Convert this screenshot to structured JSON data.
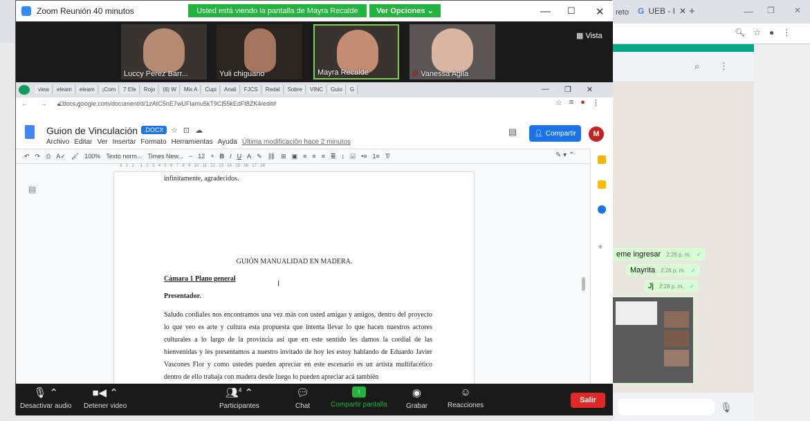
{
  "browser_bg": {
    "tab1": "reto",
    "tab2": "UEB - I",
    "new_tab": "+"
  },
  "whatsapp": {
    "messages": [
      {
        "text": "eme ingresar",
        "time": "2:28 p. m."
      },
      {
        "text": "Mayrita",
        "time": "2:28 p. m."
      },
      {
        "text": "Jj",
        "time": "2:28 p. m."
      }
    ],
    "plus": "+"
  },
  "zoom": {
    "title": "Zoom Reunión 40 minutos",
    "banner": "Usted está viendo la pantalla de Mayra Recalde",
    "view_options": "Ver Opciones",
    "vista": "Vista",
    "participants": [
      {
        "name": "Luccy Pérez Barr..."
      },
      {
        "name": "Yuli chiguano"
      },
      {
        "name": "Mayra Recalde"
      },
      {
        "name": "Vanessa Agila"
      }
    ],
    "controls": {
      "mute": "Desactivar audio",
      "video": "Detener video",
      "participants": "Participantes",
      "participants_count": "4",
      "chat": "Chat",
      "share": "Compartir pantalla",
      "record": "Grabar",
      "reactions": "Reacciones",
      "leave": "Salir"
    }
  },
  "chrome": {
    "tabs": [
      "view",
      "eleam",
      "eleam",
      "¡Com",
      "7 Efe",
      "Rojo",
      "(6) W",
      "Mix A",
      "Cupi",
      "Anali",
      "FJCS",
      "Redal",
      "Sobre",
      "VINC",
      "Guio",
      "G"
    ],
    "url": "docs.google.com/document/d/1zAtC5nE7wUFlamu5kT9Cl55kEdFt8ZK4/edit#"
  },
  "docs": {
    "title": "Guion de Vinculación",
    "ext": ".DOCX",
    "menus": [
      "Archivo",
      "Editar",
      "Ver",
      "Insertar",
      "Formato",
      "Herramientas",
      "Ayuda"
    ],
    "last_mod": "Última modificación hace 2 minutos",
    "share": "Compartir",
    "avatar": "M",
    "toolbar": {
      "zoom": "100%",
      "style": "Texto norm...",
      "font": "Times New...",
      "size": "12"
    },
    "ruler": "3 · 2 · 1 · · 1 · 2 · 3 · 4 · 5 · 6 · 7 · 8 · 9 · 10 · 11 · 12 · 13 · 14 · 15 · 16 · 17 · 18",
    "body": {
      "line0": "infinitamente, agradecidos.",
      "heading": "GUIÓN MANUALIDAD EN MADERA.",
      "subhead": "Cámara 1 Plano general",
      "presenter": "Presentador.",
      "paragraph": "Saludo cordiales nos encontramos una vez más con usted amigas y amigos, dentro del proyecto lo que veo es arte y cultura esta propuesta que intenta llevar lo que hacen nuestros actores culturales a lo largo de la provincia así que en este sentido les damos la cordial de las bienvenidas y les presentamos a nuestro invitado de hoy les estoy hablando de Eduardo Javier Vascones Flor y como ustedes pueden apreciar en este escenario es un artista multifacético dentro de ello trabaja con madera desde luego lo pueden apreciar acá también"
    }
  }
}
